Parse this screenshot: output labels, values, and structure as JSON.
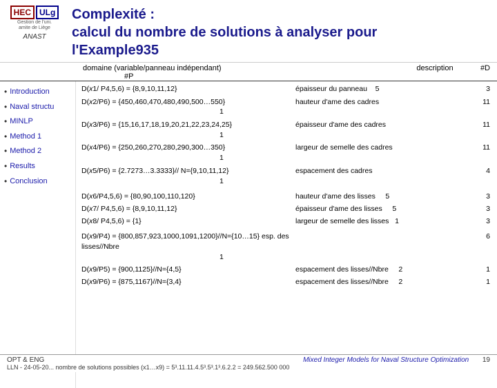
{
  "header": {
    "logo_hec": "HEC",
    "logo_ulg": "ULg",
    "logo_sub": "Gestion de l'uni. amite de Liège",
    "logo_anast": "ANAST",
    "title_line1": "Complexité :",
    "title_line2": "calcul du nombre de solutions à analyser pour",
    "title_line3": "l'Example935"
  },
  "table_headers": {
    "domain": "domaine (variable/panneau indépendant)",
    "hash_p": "#P",
    "description": "description",
    "hash_d": "#D"
  },
  "sidebar": {
    "items": [
      {
        "label": "Introduction",
        "active": false
      },
      {
        "label": "Naval structu",
        "active": false
      },
      {
        "label": "MINLP",
        "active": false
      },
      {
        "label": "Method 1",
        "active": false
      },
      {
        "label": "Method 2",
        "active": false
      },
      {
        "label": "Results",
        "active": false
      },
      {
        "label": "Conclusion",
        "active": false
      }
    ]
  },
  "rows": [
    {
      "domain": "D(x1/ P4,5,6) = {8,9,10,11,12}",
      "hash_p": "",
      "description": "épaisseur du panneau",
      "num": "5",
      "hash_d": "3"
    },
    {
      "domain": "D(x2/P6) = {450,460,470,480,490,500…550}",
      "hash_p": "1",
      "description": "hauteur d'ame des cadres",
      "num": "",
      "hash_d": "11"
    },
    {
      "domain": "D(x3/P6) = {15,16,17,18,19,20,21,22,23,24,25}",
      "hash_p": "1",
      "description": "épaisseur d'ame des cadres",
      "num": "",
      "hash_d": "11"
    },
    {
      "domain": "D(x4/P6) = {250,260,270,280,290,300…350}",
      "hash_p": "1",
      "description": "largeur de semelle des cadres",
      "num": "",
      "hash_d": "11"
    },
    {
      "domain": "D(x5/P6) = {2.7273…3.3333}// N={9,10,11,12}",
      "hash_p": "1",
      "description": "espacement des cadres",
      "num": "",
      "hash_d": "4"
    },
    {
      "domain": "D(x6/P4,5,6) = {80,90,100,110,120}",
      "hash_p": "",
      "description": "hauteur d'ame des lisses",
      "num": "5",
      "hash_d": "3"
    },
    {
      "domain": "D(x7/ P4,5,6) = {8,9,10,11,12}",
      "hash_p": "",
      "description": "épaisseur d'ame des lisses",
      "num": "5",
      "hash_d": "3"
    },
    {
      "domain": "D(x8/ P4,5,6) = {1}",
      "hash_p": "",
      "description": "largeur de semelle des lisses",
      "num": "1",
      "hash_d": "3"
    },
    {
      "domain": "D(x9/P4) = {800,857,923,1000,1091,1200}//N={10…15}",
      "hash_p": "1",
      "description": "esp. des lisses//Nbre",
      "num": "",
      "hash_d": "6"
    },
    {
      "domain": "D(x9/P5) = {900,1125}//N={4,5}",
      "hash_p": "",
      "description": "espacement des lisses//Nbre",
      "num": "2",
      "hash_d": "1"
    },
    {
      "domain": "D(x9/P6) = {875,1167}//N={3,4}",
      "hash_p": "",
      "description": "espacement des lisses//Nbre",
      "num": "2",
      "hash_d": "1"
    }
  ],
  "footer": {
    "left": "OPT & ENG",
    "center": "Mixed Integer Models for Naval Structure Optimization",
    "right": "19",
    "bottom_text": "LLN - 24-05-20... nombre de solutions possibles (x1…x9) = 5³.11.11.4.5³.5³.1³.6.2.2 = 249.562.500 000"
  }
}
